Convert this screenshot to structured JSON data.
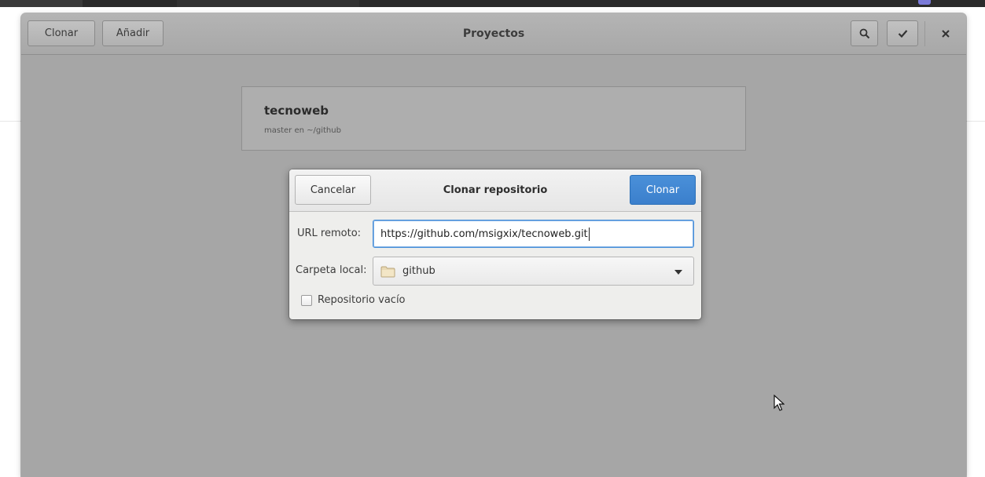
{
  "header": {
    "clone_label": "Clonar",
    "add_label": "Añadir",
    "title": "Proyectos"
  },
  "project": {
    "name": "tecnoweb",
    "subtitle": "master en ~/github"
  },
  "dialog": {
    "cancel_label": "Cancelar",
    "title": "Clonar repositorio",
    "clone_label": "Clonar",
    "url_label": "URL remoto:",
    "url_value": "https://github.com/msigxix/tecnoweb.git",
    "folder_label": "Carpeta local:",
    "folder_value": "github",
    "empty_repo_label": "Repositorio vacío",
    "empty_repo_checked": false
  },
  "icons": {
    "search": "search-icon",
    "check": "check-icon",
    "close": "close-icon",
    "folder": "folder-icon",
    "dropdown": "chevron-down-icon"
  },
  "colors": {
    "accent": "#4a90d9",
    "window_bg": "#a6a6a6",
    "dialog_bg": "#eeeeec"
  }
}
